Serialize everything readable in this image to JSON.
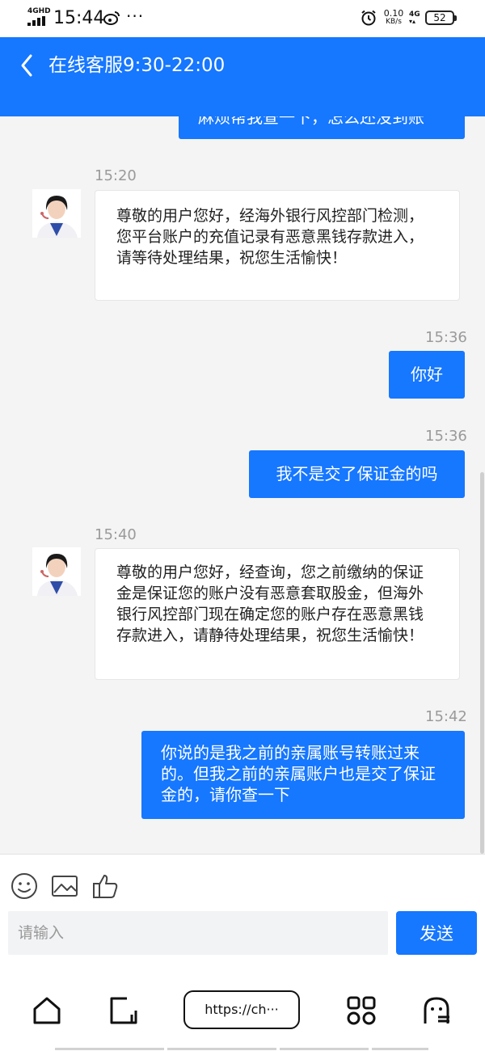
{
  "status_bar": {
    "network": "4GHD",
    "time": "15:44",
    "speed_value": "0.10",
    "speed_unit": "KB/s",
    "network_type": "4G",
    "battery": "52"
  },
  "header": {
    "title": "在线客服9:30-22:00"
  },
  "messages": [
    {
      "side": "right",
      "text": "麻烦帮我查一下，怎么还没到账"
    },
    {
      "time": "15:20",
      "side": "left",
      "text": "尊敬的用户您好，经海外银行风控部门检测，您平台账户的充值记录有恶意黑钱存款进入，请等待处理结果，祝您生活愉快！"
    },
    {
      "time": "15:36",
      "side": "right",
      "text": "你好"
    },
    {
      "time": "15:36",
      "side": "right",
      "text": "我不是交了保证金的吗"
    },
    {
      "time": "15:40",
      "side": "left",
      "text": "尊敬的用户您好，经查询，您之前缴纳的保证金是保证您的账户没有恶意套取股金，但海外银行风控部门现在确定您的账户存在恶意黑钱存款进入，请静待处理结果，祝您生活愉快！"
    },
    {
      "time": "15:42",
      "side": "right",
      "text": "你说的是我之前的亲属账号转账过来的。但我之前的亲属账户也是交了保证金的，请你查一下"
    }
  ],
  "input": {
    "placeholder": "请输入",
    "send_label": "发送"
  },
  "browser": {
    "url": "https://ch···"
  },
  "colors": {
    "brand_blue": "#1677ff",
    "bubble_white": "#ffffff",
    "chat_background": "#f4f4f4"
  }
}
